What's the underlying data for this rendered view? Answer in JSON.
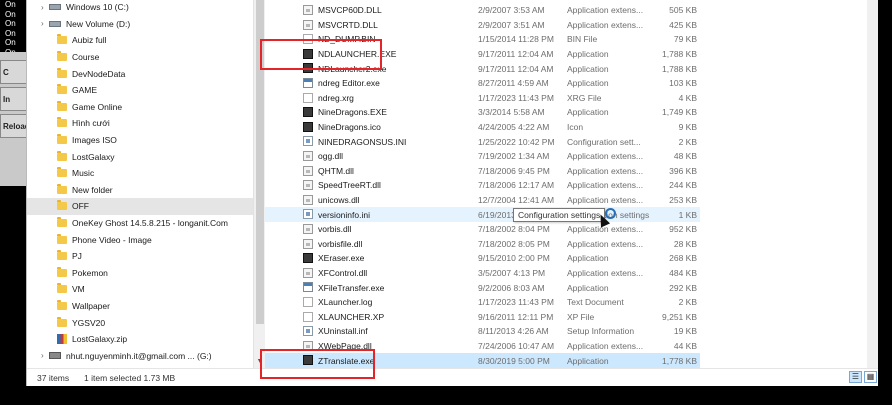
{
  "left_strip": {
    "on_labels": [
      "On",
      "On",
      "On",
      "On",
      "On",
      "On"
    ],
    "buttons": [
      "C",
      "In",
      "Reload"
    ]
  },
  "nav": {
    "items": [
      {
        "label": "Windows 10 (C:)",
        "type": "drive",
        "indent": 1
      },
      {
        "label": "New Volume (D:)",
        "type": "drive",
        "indent": 1
      },
      {
        "label": "Aubiz full",
        "type": "folder",
        "indent": 2
      },
      {
        "label": "Course",
        "type": "folder",
        "indent": 2
      },
      {
        "label": "DevNodeData",
        "type": "folder",
        "indent": 2
      },
      {
        "label": "GAME",
        "type": "folder",
        "indent": 2
      },
      {
        "label": "Game Online",
        "type": "folder",
        "indent": 2
      },
      {
        "label": "Hình cưới",
        "type": "folder",
        "indent": 2
      },
      {
        "label": "Images ISO",
        "type": "folder",
        "indent": 2
      },
      {
        "label": "LostGalaxy",
        "type": "folder",
        "indent": 2
      },
      {
        "label": "Music",
        "type": "folder",
        "indent": 2
      },
      {
        "label": "New folder",
        "type": "folder",
        "indent": 2
      },
      {
        "label": "OFF",
        "type": "folder",
        "indent": 2,
        "selected": true
      },
      {
        "label": "OneKey Ghost 14.5.8.215 - longanit.Com",
        "type": "folder",
        "indent": 2
      },
      {
        "label": "Phone Video - Image",
        "type": "folder",
        "indent": 2
      },
      {
        "label": "PJ",
        "type": "folder",
        "indent": 2
      },
      {
        "label": "Pokemon",
        "type": "folder",
        "indent": 2
      },
      {
        "label": "VM",
        "type": "folder",
        "indent": 2
      },
      {
        "label": "Wallpaper",
        "type": "folder",
        "indent": 2
      },
      {
        "label": "YGSV20",
        "type": "folder",
        "indent": 2
      },
      {
        "label": "LostGalaxy.zip",
        "type": "zip",
        "indent": 2
      },
      {
        "label": "nhut.nguyenminh.it@gmail.com ... (G:)",
        "type": "netdrive",
        "indent": 1
      }
    ]
  },
  "files": [
    {
      "name": "MSVCP60D.DLL",
      "date": "2/9/2007 3:53 AM",
      "type": "Application extens...",
      "size": "505 KB",
      "icon": "dll"
    },
    {
      "name": "MSVCRTD.DLL",
      "date": "2/9/2007 3:51 AM",
      "type": "Application extens...",
      "size": "425 KB",
      "icon": "dll"
    },
    {
      "name": "ND_DUMP.BIN",
      "date": "1/15/2014 11:28 PM",
      "type": "BIN File",
      "size": "79 KB",
      "icon": "file"
    },
    {
      "name": "NDLAUNCHER.EXE",
      "date": "9/17/2011 12:04 AM",
      "type": "Application",
      "size": "1,788 KB",
      "icon": "dark"
    },
    {
      "name": "NDLauncher2.exe",
      "date": "9/17/2011 12:04 AM",
      "type": "Application",
      "size": "1,788 KB",
      "icon": "dark"
    },
    {
      "name": "ndreg Editor.exe",
      "date": "8/27/2011 4:59 AM",
      "type": "Application",
      "size": "103 KB",
      "icon": "app"
    },
    {
      "name": "ndreg.xrg",
      "date": "1/17/2023 11:43 PM",
      "type": "XRG File",
      "size": "4 KB",
      "icon": "file"
    },
    {
      "name": "NineDragons.EXE",
      "date": "3/3/2014 5:58 AM",
      "type": "Application",
      "size": "1,749 KB",
      "icon": "dark"
    },
    {
      "name": "NineDragons.ico",
      "date": "4/24/2005 4:22 AM",
      "type": "Icon",
      "size": "9 KB",
      "icon": "dark"
    },
    {
      "name": "NINEDRAGONSUS.INI",
      "date": "1/25/2022 10:42 PM",
      "type": "Configuration sett...",
      "size": "2 KB",
      "icon": "ini"
    },
    {
      "name": "ogg.dll",
      "date": "7/19/2002 1:34 AM",
      "type": "Application extens...",
      "size": "48 KB",
      "icon": "dll"
    },
    {
      "name": "QHTM.dll",
      "date": "7/18/2006 9:45 PM",
      "type": "Application extens...",
      "size": "396 KB",
      "icon": "dll"
    },
    {
      "name": "SpeedTreeRT.dll",
      "date": "7/18/2006 12:17 AM",
      "type": "Application extens...",
      "size": "244 KB",
      "icon": "dll"
    },
    {
      "name": "unicows.dll",
      "date": "12/7/2004 12:41 AM",
      "type": "Application extens...",
      "size": "253 KB",
      "icon": "dll"
    },
    {
      "name": "versioninfo.ini",
      "date": "6/19/2013 11:56 PM",
      "type": "Configuration settings",
      "size": "1 KB",
      "icon": "ini",
      "hover": true
    },
    {
      "name": "vorbis.dll",
      "date": "7/18/2002 8:04 PM",
      "type": "Application extens...",
      "size": "952 KB",
      "icon": "dll"
    },
    {
      "name": "vorbisfile.dll",
      "date": "7/18/2002 8:05 PM",
      "type": "Application extens...",
      "size": "28 KB",
      "icon": "dll"
    },
    {
      "name": "XEraser.exe",
      "date": "9/15/2010 2:00 PM",
      "type": "Application",
      "size": "268 KB",
      "icon": "dark"
    },
    {
      "name": "XFControl.dll",
      "date": "3/5/2007 4:13 PM",
      "type": "Application extens...",
      "size": "484 KB",
      "icon": "dll"
    },
    {
      "name": "XFileTransfer.exe",
      "date": "9/2/2006 8:03 AM",
      "type": "Application",
      "size": "292 KB",
      "icon": "app"
    },
    {
      "name": "XLauncher.log",
      "date": "1/17/2023 11:43 PM",
      "type": "Text Document",
      "size": "2 KB",
      "icon": "file"
    },
    {
      "name": "XLAUNCHER.XP",
      "date": "9/16/2011 12:11 PM",
      "type": "XP File",
      "size": "9,251 KB",
      "icon": "file"
    },
    {
      "name": "XUninstall.inf",
      "date": "8/11/2013 4:26 AM",
      "type": "Setup Information",
      "size": "19 KB",
      "icon": "ini"
    },
    {
      "name": "XWebPage.dll",
      "date": "7/24/2006 10:47 AM",
      "type": "Application extens...",
      "size": "44 KB",
      "icon": "dll"
    },
    {
      "name": "ZTranslate.exe",
      "date": "8/30/2019 5:00 PM",
      "type": "Application",
      "size": "1,778 KB",
      "icon": "dark",
      "selected": true
    }
  ],
  "tooltip": {
    "text": "Configuration settings"
  },
  "status": {
    "item_count": "37 items",
    "selection": "1 item selected  1.73 MB"
  },
  "colors": {
    "selection": "#cce8ff",
    "hover": "#e5f3ff",
    "annotation": "#e3252a",
    "folder": "#f4c94a"
  }
}
